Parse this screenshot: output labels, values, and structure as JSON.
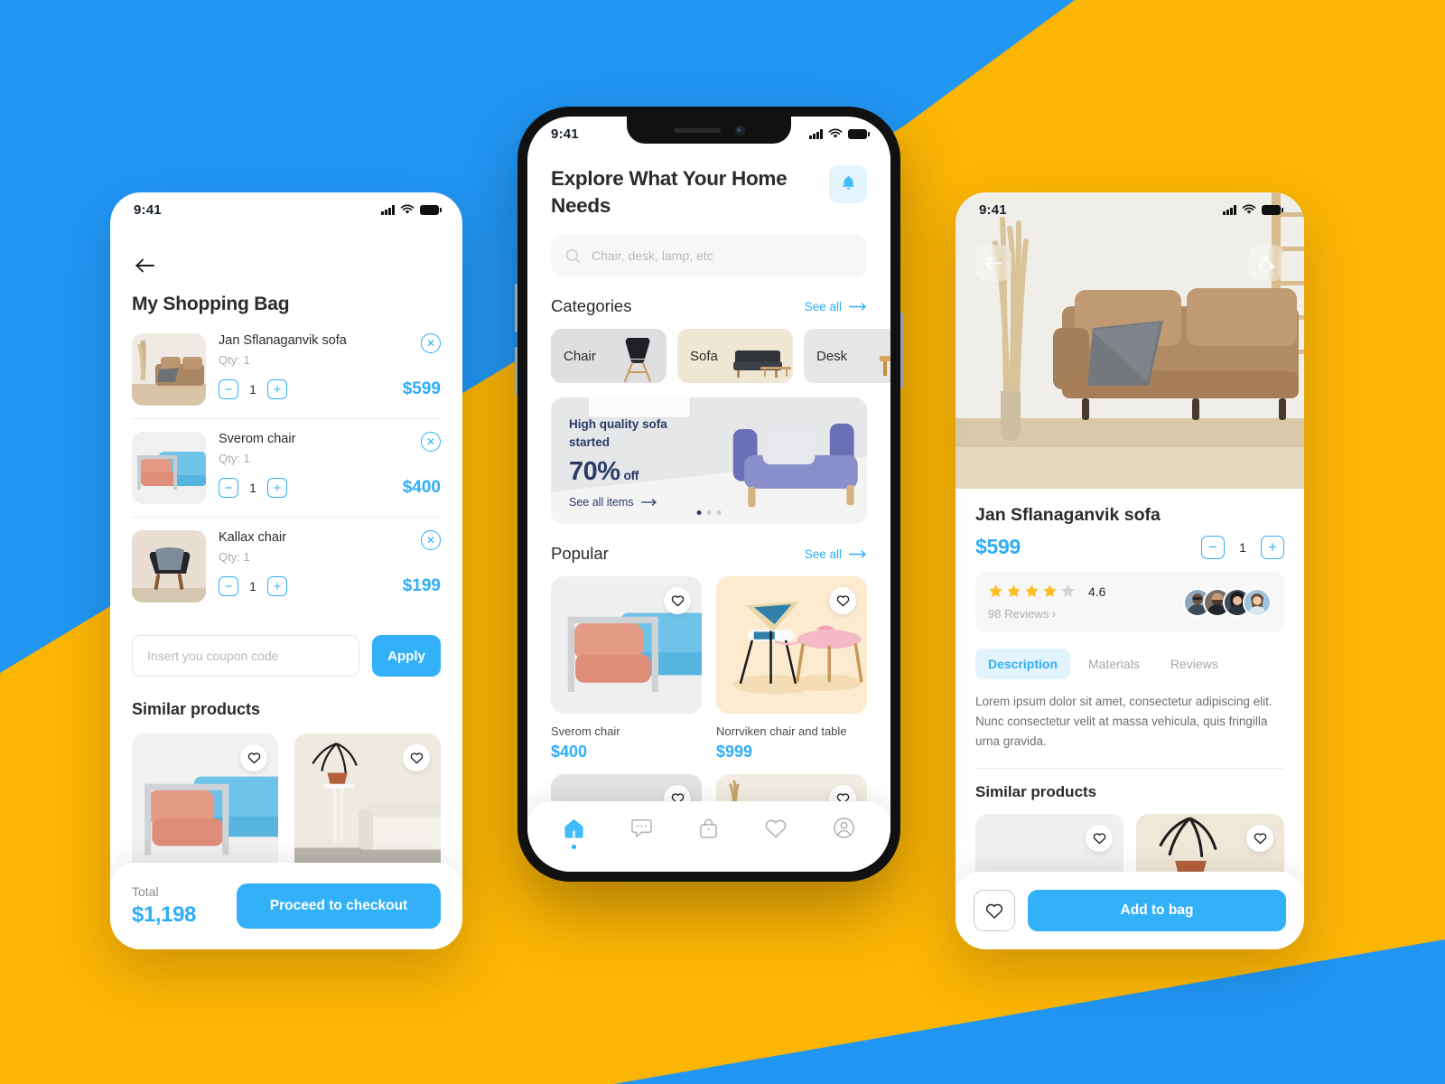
{
  "background": {
    "blue": "#2196F3",
    "yellow": "#FBB505",
    "accent": "#33B1F8"
  },
  "cart_screen": {
    "status": {
      "time": "9:41"
    },
    "back_icon": "arrow-left-icon",
    "title": "My Shopping Bag",
    "qty_label": "Qty: 1",
    "items": [
      {
        "name": "Jan Sflanaganvik sofa",
        "qty_label": "Qty: 1",
        "qty": "1",
        "price": "$599"
      },
      {
        "name": "Sverom chair",
        "qty_label": "Qty: 1",
        "qty": "1",
        "price": "$400"
      },
      {
        "name": "Kallax chair",
        "qty_label": "Qty: 1",
        "qty": "1",
        "price": "$199"
      }
    ],
    "coupon_placeholder": "Insert you coupon code",
    "coupon_value": "",
    "apply_label": "Apply",
    "similar_title": "Similar products",
    "total_label": "Total",
    "total_value": "$1,198",
    "checkout_label": "Proceed to checkout"
  },
  "home_screen": {
    "status": {
      "time": "9:41"
    },
    "title": "Explore What Your Home Needs",
    "bell_icon": "bell-icon",
    "search": {
      "icon": "search-icon",
      "placeholder": "Chair, desk, lamp, etc",
      "value": ""
    },
    "categories_title": "Categories",
    "see_all": "See all",
    "categories": [
      {
        "label": "Chair"
      },
      {
        "label": "Sofa"
      },
      {
        "label": "Desk"
      }
    ],
    "promo": {
      "line1": "High quality sofa",
      "line2": "started",
      "percent": "70%",
      "off": "off",
      "link": "See all items",
      "dots": 3,
      "active_dot": 0
    },
    "popular_title": "Popular",
    "popular": [
      {
        "name": "Sverom chair",
        "price": "$400"
      },
      {
        "name": "Norrviken chair and table",
        "price": "$999"
      }
    ],
    "tabs": [
      {
        "icon": "home-icon",
        "active": true
      },
      {
        "icon": "chat-icon",
        "active": false
      },
      {
        "icon": "bag-icon",
        "active": false
      },
      {
        "icon": "heart-icon",
        "active": false
      },
      {
        "icon": "profile-icon",
        "active": false
      }
    ]
  },
  "product_screen": {
    "status": {
      "time": "9:41"
    },
    "back_icon": "arrow-left-icon",
    "share_icon": "share-icon",
    "title": "Jan Sflanaganvik sofa",
    "price": "$599",
    "qty": "1",
    "rating": {
      "value": "4.6",
      "stars_filled": 4,
      "stars_total": 5,
      "reviews": "98 Reviews  ›"
    },
    "tabs": [
      {
        "label": "Description",
        "active": true
      },
      {
        "label": "Materials",
        "active": false
      },
      {
        "label": "Reviews",
        "active": false
      }
    ],
    "description": "Lorem ipsum dolor sit amet, consectetur adipiscing elit. Nunc consectetur velit at massa vehicula, quis fringilla urna gravida.",
    "similar_title": "Similar products",
    "fav_icon": "heart-icon",
    "add_to_bag_label": "Add to bag"
  }
}
